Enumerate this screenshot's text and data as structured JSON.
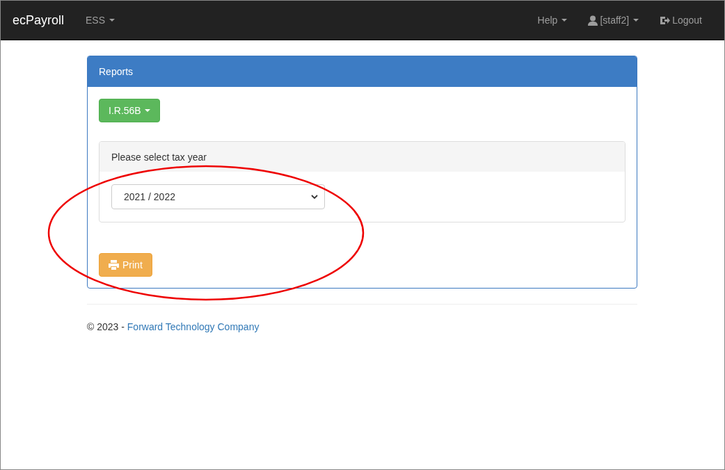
{
  "navbar": {
    "brand": "ecPayroll",
    "left_menu": [
      {
        "label": "ESS",
        "kind": "dropdown"
      }
    ],
    "right_menu": [
      {
        "label": "Help",
        "kind": "dropdown"
      },
      {
        "label": "[staff2]",
        "kind": "user"
      },
      {
        "label": "Logout",
        "kind": "logout"
      }
    ]
  },
  "panel": {
    "title": "Reports",
    "report_button": "I.R.56B",
    "tax_year": {
      "heading": "Please select tax year",
      "value": "2021 / 2022"
    },
    "print_button": "Print"
  },
  "footer": {
    "text": "© 2023 - ",
    "link": "Forward Technology Company"
  }
}
